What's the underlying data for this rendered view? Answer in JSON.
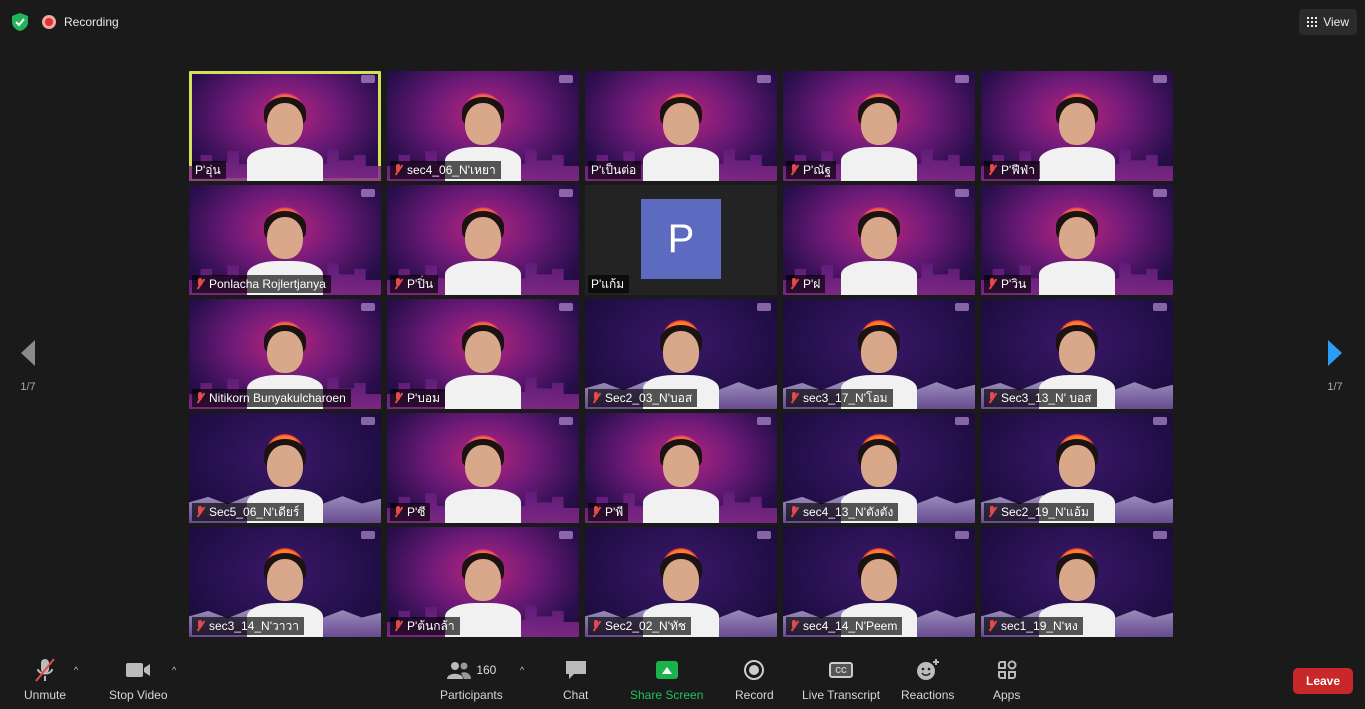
{
  "topbar": {
    "recording_label": "Recording",
    "view_label": "View"
  },
  "nav": {
    "page_indicator": "1/7"
  },
  "tiles": [
    {
      "name": "P'อุ่น",
      "style": "pink",
      "active": true,
      "muted": false
    },
    {
      "name": "sec4_06_N'เหยา",
      "style": "room",
      "active": false,
      "muted": true
    },
    {
      "name": "P'เป็นต่อ",
      "style": "pink",
      "active": false,
      "muted": false
    },
    {
      "name": "P'ณัฐ",
      "style": "pink",
      "active": false,
      "muted": true
    },
    {
      "name": "P'ฟีฟ่า",
      "style": "pink",
      "active": false,
      "muted": true
    },
    {
      "name": "Ponlacha Rojlertjanya",
      "style": "pink",
      "active": false,
      "muted": true
    },
    {
      "name": "P'ปิ่น",
      "style": "pink",
      "active": false,
      "muted": true
    },
    {
      "name": "P'แก้ม",
      "style": "avatar",
      "avatar_letter": "P",
      "active": false,
      "muted": false
    },
    {
      "name": "P'ฝ",
      "style": "pink",
      "active": false,
      "muted": true
    },
    {
      "name": "P'วิน",
      "style": "pink",
      "active": false,
      "muted": true
    },
    {
      "name": "Nitikorn Bunyakulcharoen",
      "style": "pink",
      "active": false,
      "muted": true
    },
    {
      "name": "P'บอม",
      "style": "pink",
      "active": false,
      "muted": true
    },
    {
      "name": "Sec2_03_N'บอส",
      "style": "night",
      "active": false,
      "muted": true
    },
    {
      "name": "sec3_17_N'โอม",
      "style": "night",
      "active": false,
      "muted": true
    },
    {
      "name": "Sec3_13_N' บอส",
      "style": "night",
      "active": false,
      "muted": true
    },
    {
      "name": "Sec5_06_N'เดียร์",
      "style": "night",
      "active": false,
      "muted": true
    },
    {
      "name": "P'ซี",
      "style": "pink",
      "active": false,
      "muted": true
    },
    {
      "name": "P'พี",
      "style": "pink",
      "active": false,
      "muted": true
    },
    {
      "name": "sec4_13_N'ตังตัง",
      "style": "night",
      "active": false,
      "muted": true
    },
    {
      "name": "Sec2_19_N'แอ้ม",
      "style": "night",
      "active": false,
      "muted": true
    },
    {
      "name": "sec3_14_N'วาวา",
      "style": "night",
      "active": false,
      "muted": true
    },
    {
      "name": "P'ต้นกล้า",
      "style": "pink",
      "active": false,
      "muted": true
    },
    {
      "name": "Sec2_02_N'ทัช",
      "style": "night",
      "active": false,
      "muted": true
    },
    {
      "name": "sec4_14_N'Peem",
      "style": "night",
      "active": false,
      "muted": true
    },
    {
      "name": "sec1_19_N'หง",
      "style": "night",
      "active": false,
      "muted": true
    }
  ],
  "toolbar": {
    "unmute": "Unmute",
    "stop_video": "Stop Video",
    "participants": "Participants",
    "participants_count": "160",
    "chat": "Chat",
    "share_screen": "Share Screen",
    "record": "Record",
    "live_transcript": "Live Transcript",
    "reactions": "Reactions",
    "apps": "Apps",
    "leave": "Leave",
    "cc_glyph": "CC"
  },
  "colors": {
    "share_green": "#22c05a",
    "leave_red": "#c8282a",
    "active_outline": "#d2e05c",
    "avatar_bg": "#5c6bc0"
  }
}
